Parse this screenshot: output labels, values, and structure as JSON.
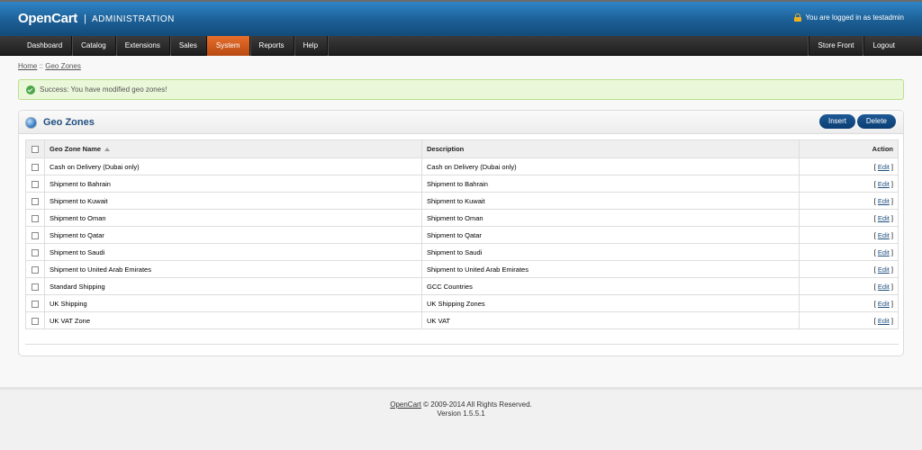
{
  "header": {
    "logo": "OpenCart",
    "separator": "|",
    "admin_label": "ADMINISTRATION",
    "login_status": "You are logged in as testadmin"
  },
  "menu": {
    "left": [
      "Dashboard",
      "Catalog",
      "Extensions",
      "Sales",
      "System",
      "Reports",
      "Help"
    ],
    "active": "System",
    "right": [
      "Store Front",
      "Logout"
    ]
  },
  "breadcrumb": {
    "home": "Home",
    "sep": " :: ",
    "current": "Geo Zones"
  },
  "alert": {
    "text": "Success: You have modified geo zones!"
  },
  "box": {
    "title": "Geo Zones",
    "insert_label": "Insert",
    "delete_label": "Delete"
  },
  "table": {
    "headers": {
      "name": "Geo Zone Name",
      "description": "Description",
      "action": "Action"
    },
    "rows": [
      {
        "name": "Cash on Delivery (Dubai only)",
        "description": "Cash on Delivery (Dubai only)",
        "action": "Edit"
      },
      {
        "name": "Shipment to Bahrain",
        "description": "Shipment to Bahrain",
        "action": "Edit"
      },
      {
        "name": "Shipment to Kuwait",
        "description": "Shipment to Kuwait",
        "action": "Edit"
      },
      {
        "name": "Shipment to Oman",
        "description": "Shipment to Oman",
        "action": "Edit"
      },
      {
        "name": "Shipment to Qatar",
        "description": "Shipment to Qatar",
        "action": "Edit"
      },
      {
        "name": "Shipment to Saudi",
        "description": "Shipment to Saudi",
        "action": "Edit"
      },
      {
        "name": "Shipment to United Arab Emirates",
        "description": "Shipment to United Arab Emirates",
        "action": "Edit"
      },
      {
        "name": "Standard Shipping",
        "description": "GCC Countries",
        "action": "Edit"
      },
      {
        "name": "UK Shipping",
        "description": "UK Shipping Zones",
        "action": "Edit"
      },
      {
        "name": "UK VAT Zone",
        "description": "UK VAT",
        "action": "Edit"
      }
    ]
  },
  "footer": {
    "link": "OpenCart",
    "copyright": " © 2009-2014 All Rights Reserved.",
    "version": "Version 1.5.5.1"
  },
  "colors": {
    "header_blue": "#1c5f95",
    "active_menu": "#e66e2a",
    "button_blue": "#0b3d73",
    "success_bg": "#eaf7d9"
  }
}
